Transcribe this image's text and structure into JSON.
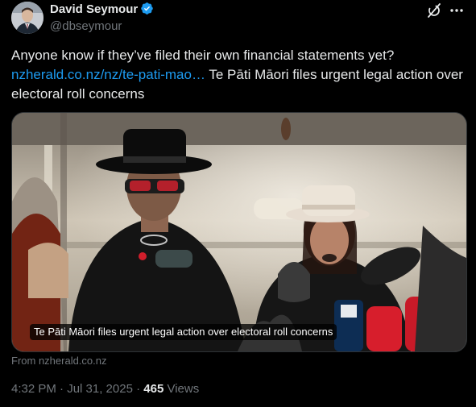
{
  "author": {
    "name": "David Seymour",
    "handle": "@dbseymour"
  },
  "icons": {
    "verified": "verified-badge-icon",
    "grok": "grok-icon",
    "more": "more-options-icon"
  },
  "tweet": {
    "text": "Anyone know if they’ve filed their own financial statements yet?",
    "link": "nzherald.co.nz/nz/te-pati-mao…",
    "headline": " Te Pāti Māori files urgent legal action over electoral roll concerns"
  },
  "card": {
    "caption": "Te Pāti Māori files urgent legal action over electoral roll concerns",
    "source": "From nzherald.co.nz"
  },
  "meta": {
    "time": "4:32 PM · Jul 31, 2025 · ",
    "views_count": "465",
    "views_label": " Views"
  },
  "colors": {
    "background": "#000000",
    "text": "#e7e9ea",
    "secondary": "#71767b",
    "link": "#1d9bf0",
    "verified": "#1d9bf0"
  }
}
